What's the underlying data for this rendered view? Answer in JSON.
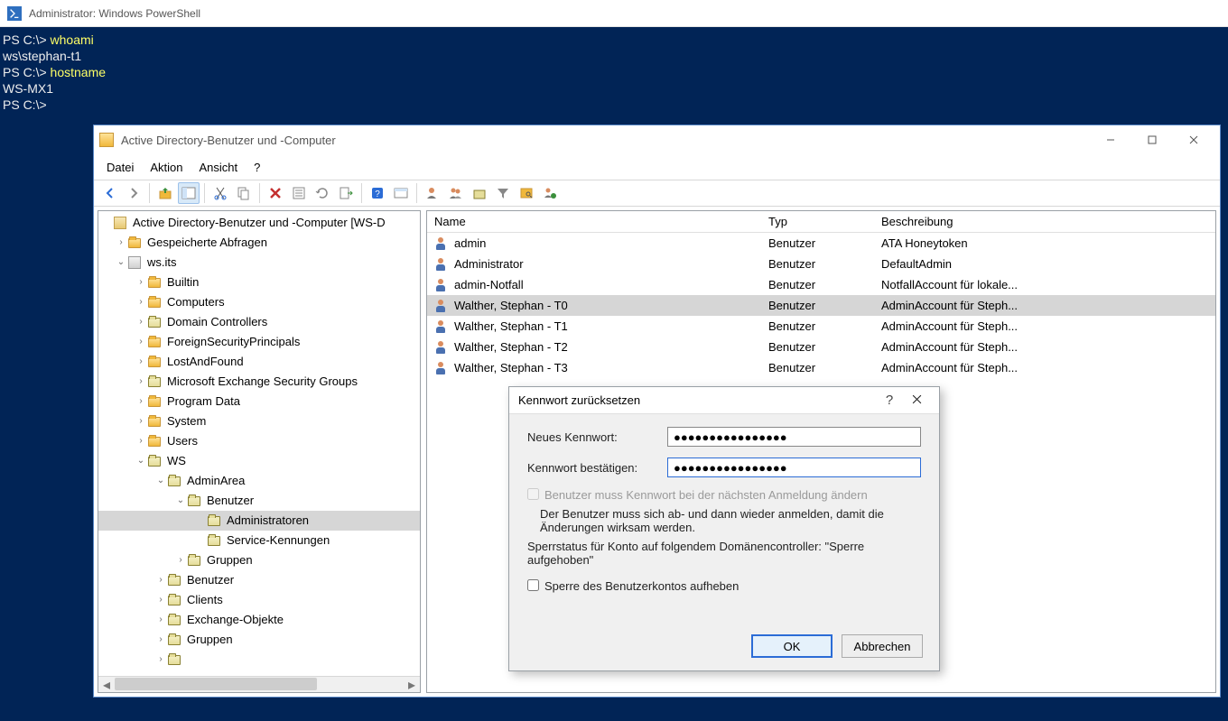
{
  "powershell": {
    "title": "Administrator: Windows PowerShell",
    "prompt": "PS C:\\> ",
    "cmd1": "whoami",
    "out1": "ws\\stephan-t1",
    "cmd2": "hostname",
    "out2": "WS-MX1",
    "prompt_blank": "PS C:\\>"
  },
  "mmc": {
    "title": "Active Directory-Benutzer und -Computer",
    "menu": {
      "file": "Datei",
      "action": "Aktion",
      "view": "Ansicht",
      "help": "?"
    },
    "tree": {
      "root": "Active Directory-Benutzer und -Computer [WS-D",
      "saved": "Gespeicherte Abfragen",
      "domain": "ws.its",
      "builtin": "Builtin",
      "computers": "Computers",
      "dcs": "Domain Controllers",
      "fsp": "ForeignSecurityPrincipals",
      "laf": "LostAndFound",
      "mesg": "Microsoft Exchange Security Groups",
      "pd": "Program Data",
      "system": "System",
      "users": "Users",
      "ws": "WS",
      "adminarea": "AdminArea",
      "benutzer": "Benutzer",
      "administratoren": "Administratoren",
      "servicekennungen": "Service-Kennungen",
      "gruppen": "Gruppen",
      "benutzer2": "Benutzer",
      "clients": "Clients",
      "exchangeobj": "Exchange-Objekte",
      "gruppen2": "Gruppen"
    },
    "columns": {
      "name": "Name",
      "type": "Typ",
      "desc": "Beschreibung"
    },
    "rows": [
      {
        "name": "admin",
        "type": "Benutzer",
        "desc": "ATA Honeytoken"
      },
      {
        "name": "Administrator",
        "type": "Benutzer",
        "desc": "DefaultAdmin"
      },
      {
        "name": "admin-Notfall",
        "type": "Benutzer",
        "desc": "NotfallAccount für lokale..."
      },
      {
        "name": "Walther, Stephan - T0",
        "type": "Benutzer",
        "desc": "AdminAccount für Steph..."
      },
      {
        "name": "Walther, Stephan - T1",
        "type": "Benutzer",
        "desc": "AdminAccount für Steph..."
      },
      {
        "name": "Walther, Stephan - T2",
        "type": "Benutzer",
        "desc": "AdminAccount für Steph..."
      },
      {
        "name": "Walther, Stephan - T3",
        "type": "Benutzer",
        "desc": "AdminAccount für Steph..."
      }
    ]
  },
  "dialog": {
    "title": "Kennwort zurücksetzen",
    "new_pw_label": "Neues Kennwort:",
    "confirm_pw_label": "Kennwort bestätigen:",
    "new_pw_value": "●●●●●●●●●●●●●●●●",
    "confirm_pw_value": "●●●●●●●●●●●●●●●●",
    "chk_must_change": "Benutzer muss Kennwort bei der nächsten Anmeldung ändern",
    "note1": "Der Benutzer muss sich ab- und dann wieder anmelden, damit die Änderungen wirksam werden.",
    "note2": "Sperrstatus für Konto auf folgendem Domänencontroller: \"Sperre aufgehoben\"",
    "chk_unlock": "Sperre des Benutzerkontos aufheben",
    "ok": "OK",
    "cancel": "Abbrechen"
  }
}
